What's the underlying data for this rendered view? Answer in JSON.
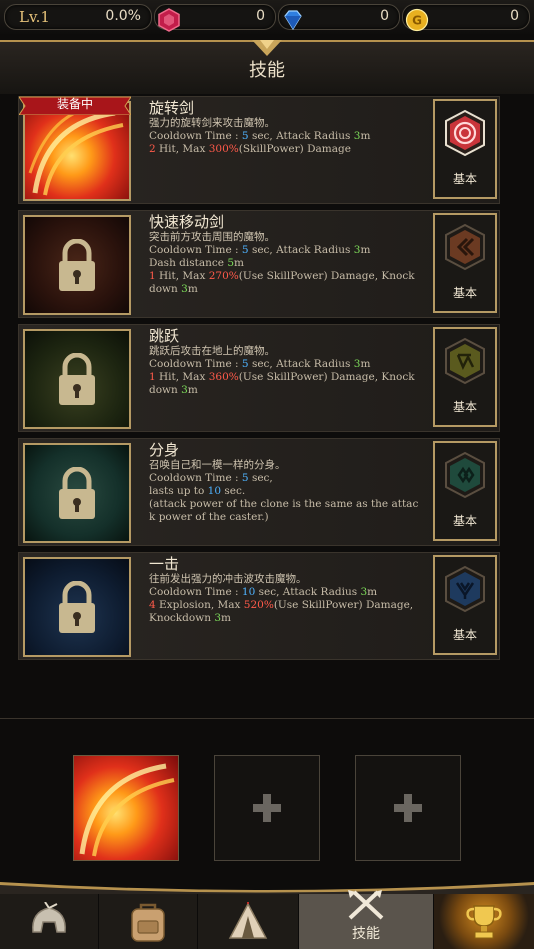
{
  "topbar": {
    "level": "Lv.1",
    "exp": "0.0%",
    "ruby": "0",
    "diamond": "0",
    "gold": "0",
    "ruby_icon": "red-gem-icon",
    "diamond_icon": "blue-diamond-icon",
    "gold_icon": "gold-coin-icon"
  },
  "header": {
    "title": "技能"
  },
  "skills": [
    {
      "ribbon": "装备中",
      "name": "旋转剑",
      "desc": "强力的旋转剑来攻击魔物。",
      "l1a": "Cooldown Time : ",
      "l1b": "5",
      "l1c": " sec, Attack Radius ",
      "l1d": "3",
      "l1e": "m",
      "l2a": "2",
      "l2b": " Hit, Max ",
      "l2c": "300%",
      "l2d": "(SkillPower) Damage",
      "badge": "基本",
      "badge_color": "#c9343a",
      "locked": false
    },
    {
      "name": "快速移动剑",
      "desc": "突击前方攻击周围的魔物。",
      "l1a": "Cooldown Time : ",
      "l1b": "5",
      "l1c": " sec, Attack Radius ",
      "l1d": "3",
      "l1e": "m",
      "l2a": "Dash distance ",
      "l2b": "5",
      "l2c": "m",
      "l3a": "1",
      "l3b": " Hit, Max ",
      "l3c": "270%",
      "l3d": "(Use SkillPower) Damage, Knock",
      "l4a": "down ",
      "l4b": "3",
      "l4c": "m",
      "badge": "基本",
      "badge_color": "#6b3a22",
      "locked": true
    },
    {
      "name": "跳跃",
      "desc": "跳跃后攻击在地上的魔物。",
      "l1a": "Cooldown Time : ",
      "l1b": "5",
      "l1c": " sec, Attack Radius ",
      "l1d": "3",
      "l1e": "m",
      "l3a": "1",
      "l3b": " Hit, Max ",
      "l3c": "360%",
      "l3d": "(Use SkillPower) Damage, Knock",
      "l4a": "down ",
      "l4b": "3",
      "l4c": "m",
      "badge": "基本",
      "badge_color": "#5a5a1e",
      "locked": true
    },
    {
      "name": "分身",
      "desc": "召唤自己和一模一样的分身。",
      "l1a": "Cooldown Time : ",
      "l1b": "5",
      "l1c": " sec,",
      "l2a": "lasts up to ",
      "l2b": "10",
      "l2c": " sec.",
      "l3": "(attack power of the clone is the same as the attac",
      "l4": "k power of the caster.)",
      "badge": "基本",
      "badge_color": "#1f4a3c",
      "locked": true
    },
    {
      "name": "一击",
      "desc": "往前发出强力的冲击波攻击魔物。",
      "l1a": "Cooldown Time : ",
      "l1b": "10",
      "l1c": " sec, Attack Radius ",
      "l1d": "3",
      "l1e": "m",
      "l2a": "4",
      "l2b": " Explosion, Max ",
      "l2c": "520%",
      "l2d": "(Use SkillPower) Damage,",
      "l3a": "Knockdown ",
      "l3b": "3",
      "l3c": "m",
      "badge": "基本",
      "badge_color": "#1e3a5e",
      "locked": true
    }
  ],
  "slots": [
    "equipped-spin-sword",
    "empty-add",
    "empty-add"
  ],
  "nav": {
    "items": [
      "helmet-icon",
      "backpack-icon",
      "tent-icon",
      "swords-icon",
      "trophy-icon"
    ],
    "active_label": "技能"
  }
}
